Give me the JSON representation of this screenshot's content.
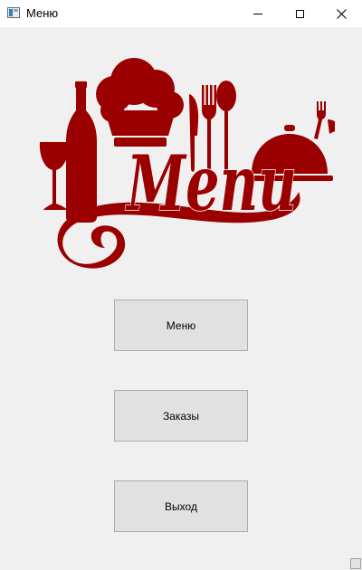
{
  "window": {
    "title": "Меню",
    "controls": [
      "minimize",
      "maximize",
      "close"
    ]
  },
  "logo": {
    "text": "Menu",
    "color": "#9b0000",
    "icons": [
      "wine-glass-icon",
      "wine-bottle-icon",
      "chef-hat-icon",
      "knife-icon",
      "fork-icon",
      "spoon-icon",
      "serving-cloche-icon"
    ]
  },
  "buttons": {
    "menu": "Меню",
    "orders": "Заказы",
    "exit": "Выход"
  },
  "colors": {
    "background": "#f0f0f0",
    "button_face": "#e1e1e1",
    "button_border": "#adadad",
    "brand": "#9b0000"
  }
}
